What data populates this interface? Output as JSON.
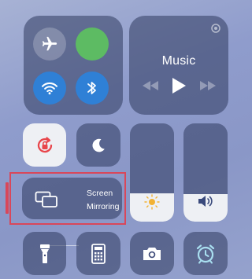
{
  "music": {
    "title": "Music"
  },
  "connectivity": {
    "airplane": {
      "icon": "airplane-icon",
      "on": false
    },
    "cellular": {
      "icon": "cellular-toggle",
      "on": true,
      "color": "#5dbb63"
    },
    "wifi": {
      "icon": "wifi-icon",
      "on": true,
      "color": "#2f80d6"
    },
    "bluetooth": {
      "icon": "bluetooth-icon",
      "on": true,
      "color": "#2f80d6"
    }
  },
  "controls": {
    "rotation_lock": {
      "icon": "rotation-lock-icon",
      "on": true,
      "color": "#e8464b"
    },
    "do_not_disturb": {
      "icon": "moon-icon",
      "on": false
    }
  },
  "screen_mirroring": {
    "label_line1": "Screen",
    "label_line2": "Mirroring",
    "highlight_color": "#d9475a"
  },
  "brightness": {
    "icon": "sun-icon",
    "level": 0.29
  },
  "volume": {
    "icon": "speaker-icon",
    "level": 0.28
  },
  "bottom_row": [
    {
      "name": "flashlight",
      "icon": "flashlight-icon"
    },
    {
      "name": "calculator",
      "icon": "calculator-icon"
    },
    {
      "name": "camera",
      "icon": "camera-icon"
    },
    {
      "name": "alarm",
      "icon": "alarm-clock-icon"
    }
  ]
}
